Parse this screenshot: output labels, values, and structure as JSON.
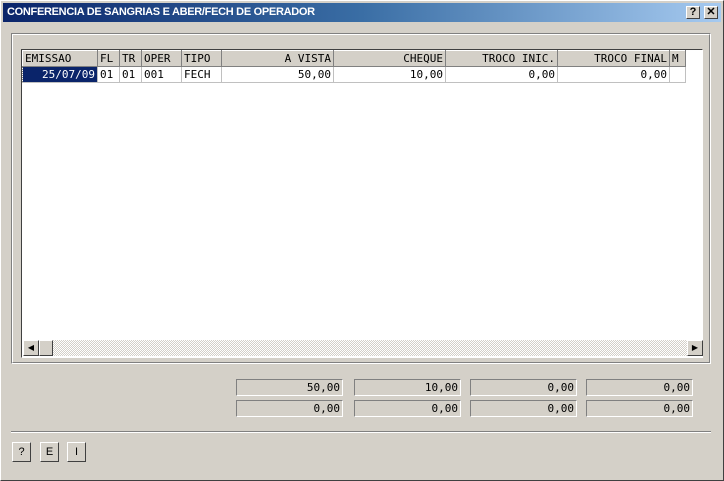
{
  "window": {
    "title": "CONFERENCIA DE SANGRIAS E ABER/FECH DE OPERADOR",
    "help_glyph": "?",
    "close_glyph": "✕"
  },
  "grid": {
    "columns": [
      "EMISSAO",
      "FL",
      "TR",
      "OPER",
      "TIPO",
      "A VISTA",
      "CHEQUE",
      "TROCO INIC.",
      "TROCO FINAL",
      "M"
    ],
    "rows": [
      [
        "25/07/09",
        "01",
        "01",
        "001",
        "FECH",
        "50,00",
        "10,00",
        "0,00",
        "0,00",
        ""
      ]
    ]
  },
  "scrollbar": {
    "left_arrow": "◀",
    "right_arrow": "▶"
  },
  "totals": {
    "row1": [
      "50,00",
      "10,00",
      "0,00",
      "0,00"
    ],
    "row2": [
      "0,00",
      "0,00",
      "0,00",
      "0,00"
    ]
  },
  "footer_buttons": {
    "help": "?",
    "e": "E",
    "i": "I"
  }
}
